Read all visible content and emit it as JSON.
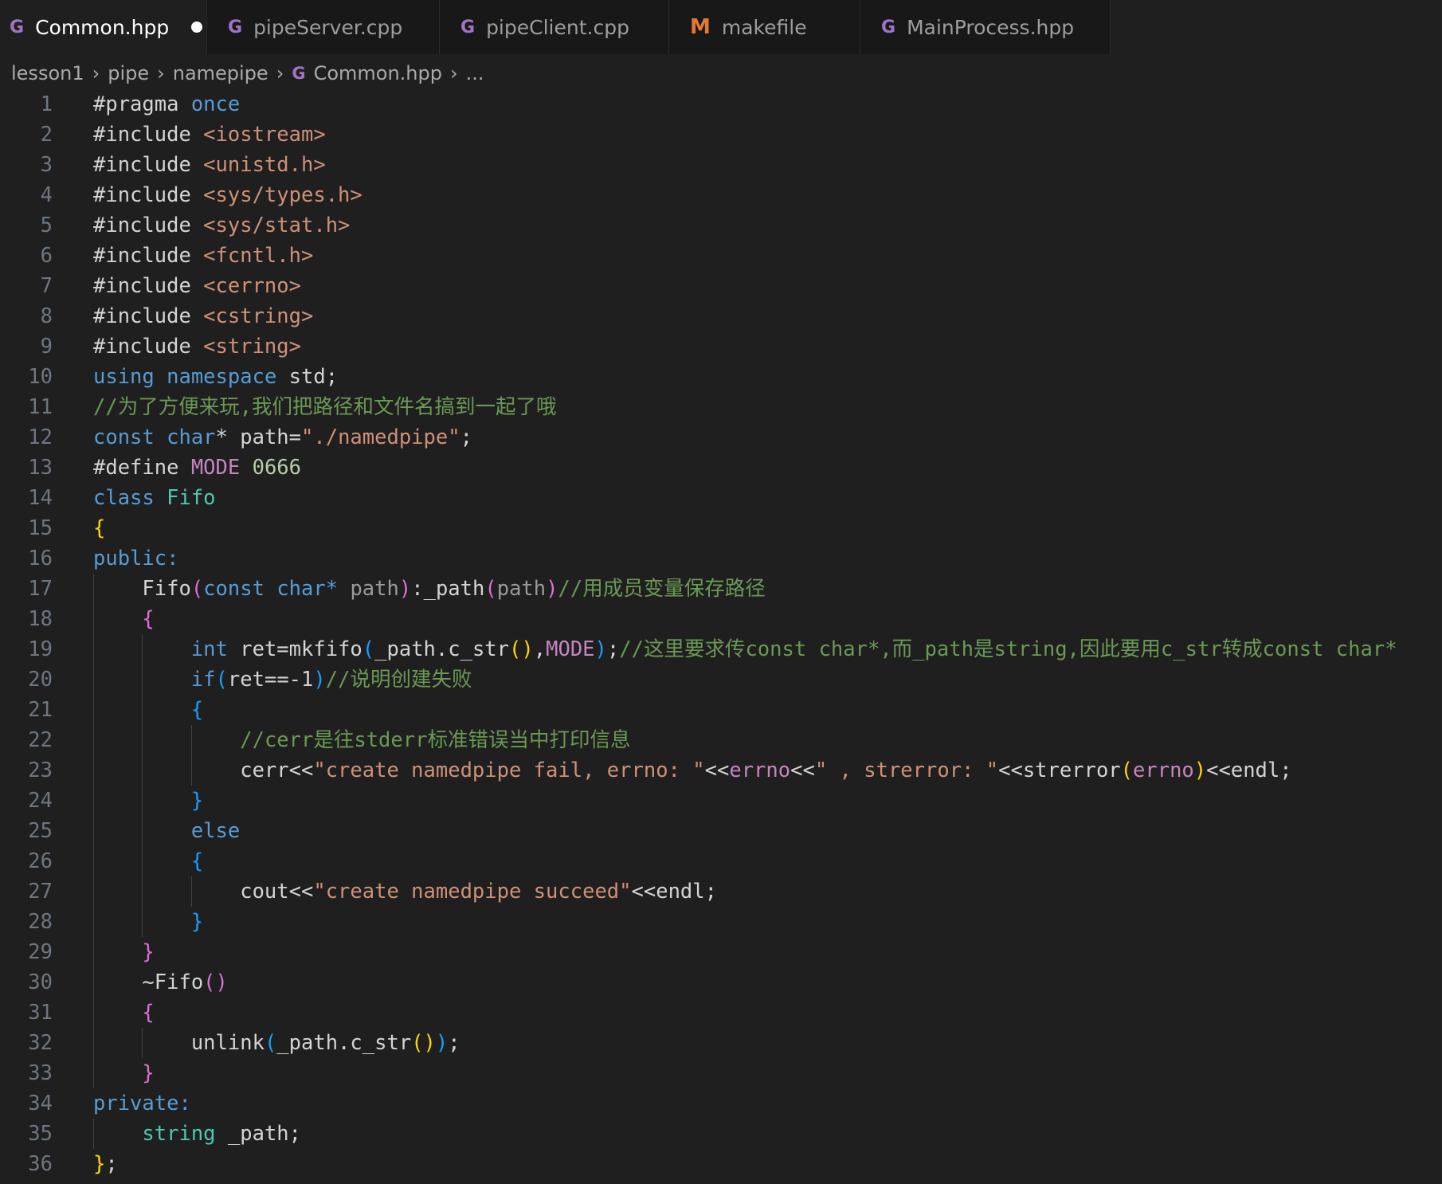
{
  "tabs": [
    {
      "label": "Common.hpp",
      "icon": "cpp-icon",
      "active": true,
      "dirty": true
    },
    {
      "label": "pipeServer.cpp",
      "icon": "cpp-icon"
    },
    {
      "label": "pipeClient.cpp",
      "icon": "cpp-icon"
    },
    {
      "label": "makefile",
      "icon": "makefile-icon"
    },
    {
      "label": "MainProcess.hpp",
      "icon": "cpp-icon"
    }
  ],
  "breadcrumb": [
    "lesson1",
    "pipe",
    "namepipe",
    "Common.hpp",
    "..."
  ],
  "colors": {
    "background": "#1f1f1f",
    "keyword": "#569cd6",
    "preprocessor": "#c586c0",
    "type": "#4ec9b0",
    "string": "#ce9178",
    "comment": "#6a9955",
    "bracket_gold": "#ffd700",
    "bracket_orchid": "#da70d6",
    "bracket_blue": "#179fff"
  },
  "code_lines": [
    [
      [
        "pl",
        "#pragma "
      ],
      [
        "kw",
        "once"
      ]
    ],
    [
      [
        "pl",
        "#include "
      ],
      [
        "st",
        "<iostream>"
      ]
    ],
    [
      [
        "pl",
        "#include "
      ],
      [
        "st",
        "<unistd.h>"
      ]
    ],
    [
      [
        "pl",
        "#include "
      ],
      [
        "st",
        "<sys/types.h>"
      ]
    ],
    [
      [
        "pl",
        "#include "
      ],
      [
        "st",
        "<sys/stat.h>"
      ]
    ],
    [
      [
        "pl",
        "#include "
      ],
      [
        "st",
        "<fcntl.h>"
      ]
    ],
    [
      [
        "pl",
        "#include "
      ],
      [
        "st",
        "<cerrno>"
      ]
    ],
    [
      [
        "pl",
        "#include "
      ],
      [
        "st",
        "<cstring>"
      ]
    ],
    [
      [
        "pl",
        "#include "
      ],
      [
        "st",
        "<string>"
      ]
    ],
    [
      [
        "kw",
        "using "
      ],
      [
        "kw",
        "namespace "
      ],
      [
        "pl",
        "std;"
      ]
    ],
    [
      [
        "cm",
        "//为了方便来玩,我们把路径和文件名搞到一起了哦"
      ]
    ],
    [
      [
        "kw",
        "const "
      ],
      [
        "kw",
        "char"
      ],
      [
        "pl",
        "* path="
      ],
      [
        "st",
        "\"./namedpipe\""
      ],
      [
        "pl",
        ";"
      ]
    ],
    [
      [
        "pl",
        "#define "
      ],
      [
        "mc",
        "MODE "
      ],
      [
        "nu",
        "0666"
      ]
    ],
    [
      [
        "kw",
        "class "
      ],
      [
        "ty",
        "Fifo"
      ]
    ],
    [
      [
        "b1",
        "{"
      ]
    ],
    [
      [
        "kw",
        "public:"
      ]
    ],
    [
      [
        "pl",
        "    Fifo"
      ],
      [
        "b2",
        "("
      ],
      [
        "kw",
        "const "
      ],
      [
        "kw",
        "char"
      ],
      [
        "kw",
        "* "
      ],
      [
        "pa",
        "path"
      ],
      [
        "b2",
        ")"
      ],
      [
        "pl",
        ":_path"
      ],
      [
        "b2",
        "("
      ],
      [
        "pa",
        "path"
      ],
      [
        "b2",
        ")"
      ],
      [
        "cm",
        "//用成员变量保存路径"
      ]
    ],
    [
      [
        "pl",
        "    "
      ],
      [
        "b2",
        "{"
      ]
    ],
    [
      [
        "pl",
        "        "
      ],
      [
        "kw",
        "int "
      ],
      [
        "pl",
        "ret=mkfifo"
      ],
      [
        "b3",
        "("
      ],
      [
        "pl",
        "_path.c_str"
      ],
      [
        "b1",
        "()"
      ],
      [
        "pl",
        ","
      ],
      [
        "mc",
        "MODE"
      ],
      [
        "b3",
        ")"
      ],
      [
        "pl",
        ";"
      ],
      [
        "cm",
        "//这里要求传const char*,而_path是string,因此要用c_str转成const char*"
      ]
    ],
    [
      [
        "pl",
        "        "
      ],
      [
        "kw",
        "if"
      ],
      [
        "b3",
        "("
      ],
      [
        "pl",
        "ret==-1"
      ],
      [
        "b3",
        ")"
      ],
      [
        "cm",
        "//说明创建失败"
      ]
    ],
    [
      [
        "pl",
        "        "
      ],
      [
        "b3",
        "{"
      ]
    ],
    [
      [
        "pl",
        "            "
      ],
      [
        "cm",
        "//cerr是往stderr标准错误当中打印信息"
      ]
    ],
    [
      [
        "pl",
        "            cerr<<"
      ],
      [
        "st",
        "\"create namedpipe fail, errno: \""
      ],
      [
        "pl",
        "<<"
      ],
      [
        "mc",
        "errno"
      ],
      [
        "pl",
        "<<"
      ],
      [
        "st",
        "\" , strerror: \""
      ],
      [
        "pl",
        "<<strerror"
      ],
      [
        "b1",
        "("
      ],
      [
        "mc",
        "errno"
      ],
      [
        "b1",
        ")"
      ],
      [
        "pl",
        "<<endl;"
      ]
    ],
    [
      [
        "pl",
        "        "
      ],
      [
        "b3",
        "}"
      ]
    ],
    [
      [
        "pl",
        "        "
      ],
      [
        "kw",
        "else"
      ]
    ],
    [
      [
        "pl",
        "        "
      ],
      [
        "b3",
        "{"
      ]
    ],
    [
      [
        "pl",
        "            cout<<"
      ],
      [
        "st",
        "\"create namedpipe succeed\""
      ],
      [
        "pl",
        "<<endl;"
      ]
    ],
    [
      [
        "pl",
        "        "
      ],
      [
        "b3",
        "}"
      ]
    ],
    [
      [
        "pl",
        "    "
      ],
      [
        "b2",
        "}"
      ]
    ],
    [
      [
        "pl",
        "    ~Fifo"
      ],
      [
        "b2",
        "()"
      ]
    ],
    [
      [
        "pl",
        "    "
      ],
      [
        "b2",
        "{"
      ]
    ],
    [
      [
        "pl",
        "        unlink"
      ],
      [
        "b3",
        "("
      ],
      [
        "pl",
        "_path.c_str"
      ],
      [
        "b1",
        "()"
      ],
      [
        "b3",
        ")"
      ],
      [
        "pl",
        ";"
      ]
    ],
    [
      [
        "pl",
        "    "
      ],
      [
        "b2",
        "}"
      ]
    ],
    [
      [
        "kw",
        "private:"
      ]
    ],
    [
      [
        "pl",
        "    "
      ],
      [
        "ty",
        "string "
      ],
      [
        "pl",
        "_path;"
      ]
    ],
    [
      [
        "b1",
        "}"
      ],
      [
        "pl",
        ";"
      ]
    ]
  ]
}
